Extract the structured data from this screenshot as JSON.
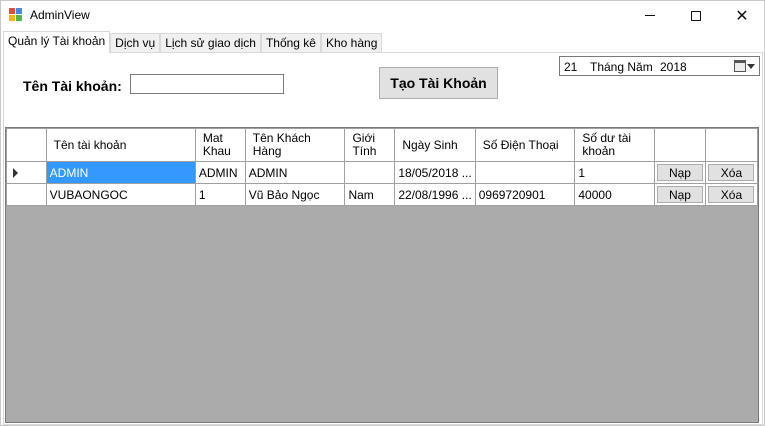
{
  "window": {
    "title": "AdminView",
    "icon": "winforms-app-icon",
    "controls": {
      "minimize": "minimize-icon",
      "maximize": "maximize-icon",
      "close": "close-icon"
    }
  },
  "tabs": [
    {
      "label": "Quản lý Tài khoản",
      "active": true
    },
    {
      "label": "Dịch vụ",
      "active": false
    },
    {
      "label": "Lịch sử giao dịch",
      "active": false
    },
    {
      "label": "Thống kê",
      "active": false
    },
    {
      "label": "Kho hàng",
      "active": false
    }
  ],
  "form": {
    "account_label": "Tên Tài khoản:",
    "account_value": "",
    "create_button": "Tạo Tài Khoản"
  },
  "datepicker": {
    "day": "21",
    "month_text": "Tháng Năm",
    "year": "2018",
    "icon": "calendar-dropdown-icon"
  },
  "grid": {
    "columns": [
      "Tên tài khoản",
      "Mat Khau",
      "Tên Khách Hàng",
      "Giới Tính",
      "Ngày Sinh",
      "Số Điện Thoại",
      "Số dư tài khoản",
      "",
      ""
    ],
    "rows": [
      {
        "current": true,
        "cells": [
          "ADMIN",
          "ADMIN",
          "ADMIN",
          "",
          "18/05/2018 ...",
          "",
          "1"
        ],
        "recharge_label": "Nạp",
        "delete_label": "Xóa"
      },
      {
        "current": false,
        "cells": [
          "VUBAONGOC",
          "1",
          "Vũ Bảo Ngọc",
          "Nam",
          "22/08/1996 ...",
          "0969720901",
          "40000"
        ],
        "recharge_label": "Nạp",
        "delete_label": "Xóa"
      }
    ],
    "colors": {
      "selection": "#3399ff",
      "empty_area": "#ababab"
    }
  }
}
